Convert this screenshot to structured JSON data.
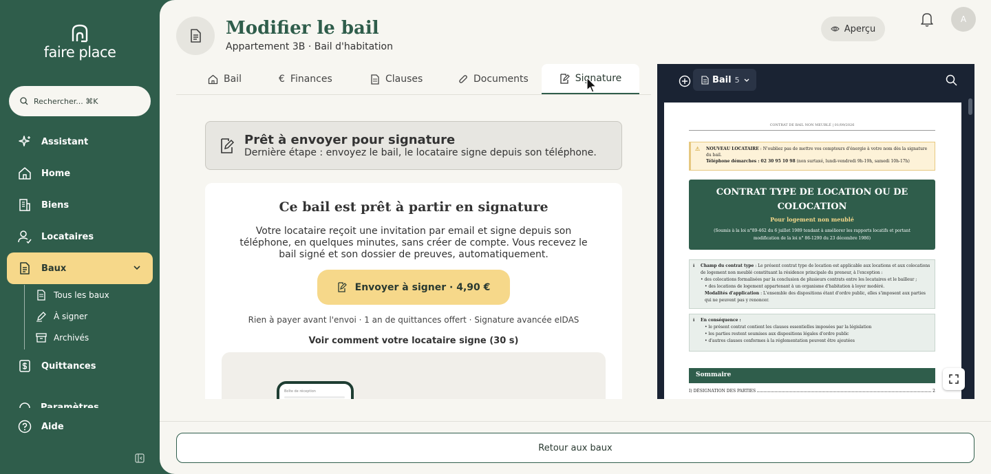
{
  "brand": {
    "name": "faire place"
  },
  "search": {
    "placeholder": "Rechercher... ⌘K"
  },
  "sidebar": {
    "items": [
      {
        "label": "Assistant",
        "icon": "sparkle-icon"
      },
      {
        "label": "Home",
        "icon": "home-icon"
      },
      {
        "label": "Biens",
        "icon": "building-icon"
      },
      {
        "label": "Locataires",
        "icon": "user-icon"
      },
      {
        "label": "Baux",
        "icon": "document-icon",
        "active": true
      },
      {
        "label": "Quittances",
        "icon": "receipt-icon"
      },
      {
        "label": "Aide",
        "icon": "help-icon"
      }
    ],
    "sub_items": [
      {
        "label": "Tous les baux",
        "icon": "document-icon"
      },
      {
        "label": "À signer",
        "icon": "pen-icon"
      },
      {
        "label": "Archivés",
        "icon": "archive-icon"
      }
    ],
    "partial_item": "Paramètres"
  },
  "header": {
    "title": "Modifier le bail",
    "subtitle": "Appartement 3B · Bail d'habitation",
    "preview_label": "Aperçu",
    "avatar_initial": "A"
  },
  "tabs": [
    {
      "label": "Bail",
      "icon": "home-icon"
    },
    {
      "label": "Finances",
      "icon": "euro-icon"
    },
    {
      "label": "Clauses",
      "icon": "document-icon"
    },
    {
      "label": "Documents",
      "icon": "paperclip-icon"
    },
    {
      "label": "Signature",
      "icon": "sign-icon",
      "active": true
    }
  ],
  "banner": {
    "title": "Prêt à envoyer pour signature",
    "text": "Dernière étape : envoyez le bail, le locataire signe depuis son téléphone."
  },
  "card": {
    "title": "Ce bail est prêt à partir en signature",
    "text": "Votre locataire reçoit une invitation par email et signe depuis son téléphone, en quelques minutes, sans créer de compte. Vous recevez le bail signé et son dossier de preuves, automatiquement.",
    "button": "Envoyer à signer · 4,90 €",
    "note": "Rien à payer avant l'envoi · 1 an de quittances offert · Signature avancée eIDAS",
    "link": "Voir comment votre locataire signe (30 s)",
    "phone_label": "Boîte de réception"
  },
  "preview": {
    "doc_label": "Bail",
    "page_count": "5",
    "paper": {
      "header": "CONTRAT DE BAIL NON MEUBLÉ | 01/09/2026",
      "warn_title": "NOUVEAU LOCATAIRE",
      "warn_text": " : N'oubliez pas de mettre vos compteurs d'énergie à votre nom dès la signature du bail.",
      "warn_phone_label": "Téléphone démarches : 02 30 95 10 98",
      "warn_phone_note": " (non surtaxé, lundi-vendredi 9h-19h, samedi 10h-17h)",
      "title": "CONTRAT TYPE DE LOCATION OU DE COLOCATION",
      "subtitle": "Pour logement non meublé",
      "legal": "(Soumis à la loi n°89-462 du 6 juillet 1989 tendant à améliorer les rapports locatifs et portant modification de la loi n° 86-1290 du 23 décembre 1986)",
      "box1_label": "Champ du contrat type",
      "box1_text": " : Le présent contrat type de location est applicable aux locations et aux colocations de logement non meublé constituant la résidence principale du preneur, à l'exception :",
      "box1_b1": "• des colocations formalisées par la conclusion de plusieurs contrats entre les locataires et le bailleur ;",
      "box1_b2": "• des locations de logement appartenant à un organisme d'habitation à loyer modéré.",
      "box1_mod_label": "Modalités d'application",
      "box1_mod_text": " : L'ensemble des dispositions étant d'ordre public, elles s'imposent aux parties qui ne peuvent pas y renoncer.",
      "box2_label": "En conséquence :",
      "box2_b1": "• le présent contrat contient les clauses essentielles imposées par la législation",
      "box2_b2": "• les parties restent soumises aux dispositions légales d'ordre public",
      "box2_b3": "• d'autres clauses conformes à la réglementation peuvent être ajoutées",
      "sommaire": "Sommaire",
      "toc_item": "I) DÉSIGNATION DES PARTIES",
      "toc_page": "2"
    }
  },
  "footer": {
    "back_label": "Retour aux baux"
  },
  "colors": {
    "brand_green": "#2f5d4b",
    "accent_yellow": "#f6d88a",
    "preview_bg": "#1a2333"
  }
}
